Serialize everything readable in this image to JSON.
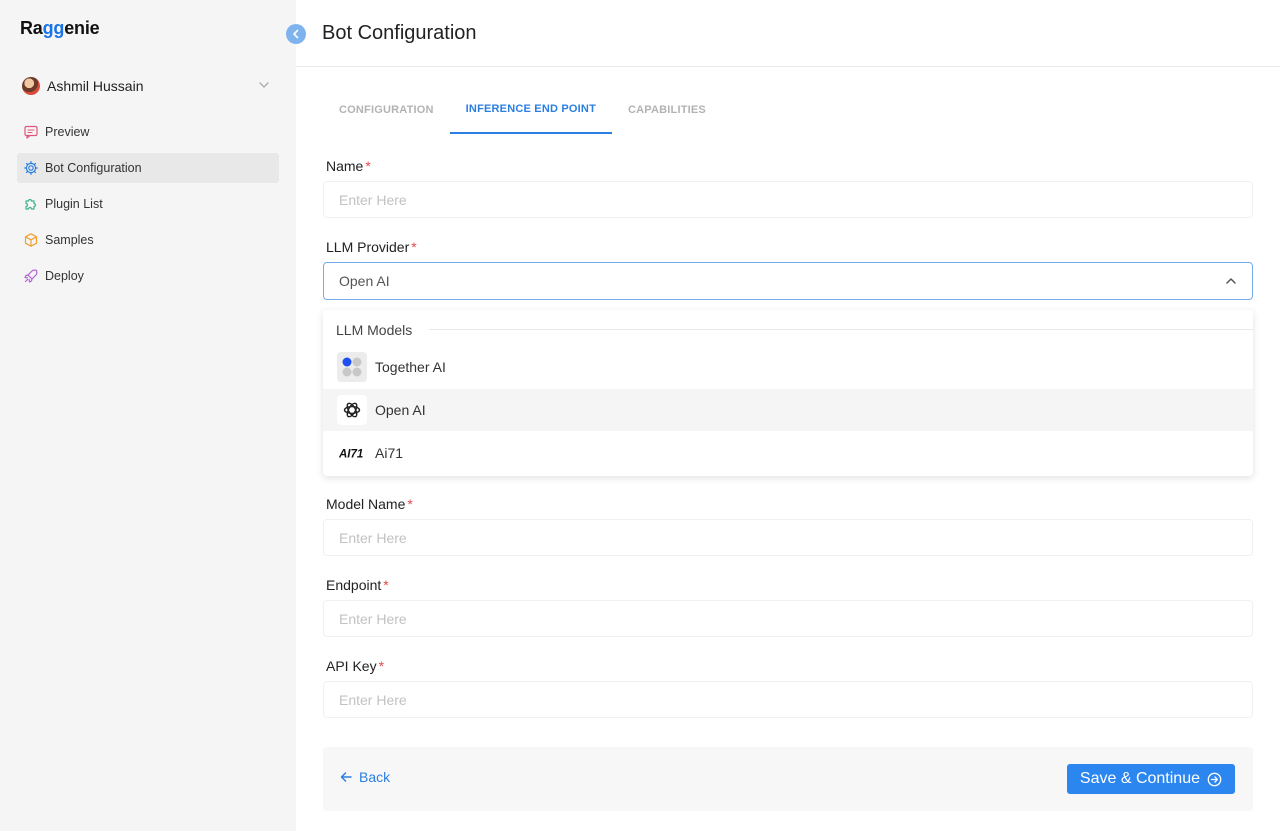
{
  "app": {
    "logo_pre": "Ra",
    "logo_accent": "gg",
    "logo_post": "enie"
  },
  "user": {
    "name": "Ashmil Hussain"
  },
  "sidebar": {
    "items": [
      {
        "label": "Preview",
        "icon": "chat-icon"
      },
      {
        "label": "Bot Configuration",
        "icon": "gear-icon",
        "active": true
      },
      {
        "label": "Plugin List",
        "icon": "puzzle-icon"
      },
      {
        "label": "Samples",
        "icon": "box-icon"
      },
      {
        "label": "Deploy",
        "icon": "rocket-icon"
      }
    ]
  },
  "header": {
    "title": "Bot Configuration"
  },
  "tabs": [
    {
      "label": "CONFIGURATION",
      "active": false
    },
    {
      "label": "INFERENCE END POINT",
      "active": true
    },
    {
      "label": "CAPABILITIES",
      "active": false
    }
  ],
  "form": {
    "name": {
      "label": "Name",
      "required": "*",
      "placeholder": "Enter Here",
      "value": ""
    },
    "provider": {
      "label": "LLM Provider",
      "required": "*",
      "value": "Open AI",
      "dropdown_group": "LLM Models",
      "options": [
        {
          "label": "Together AI",
          "icon": "together-ai-logo-icon"
        },
        {
          "label": "Open AI",
          "icon": "openai-logo-icon",
          "hovered": true
        },
        {
          "label": "Ai71",
          "icon": "ai71-logo-icon",
          "logo_text": "AI71"
        }
      ]
    },
    "model_name": {
      "label": "Model Name",
      "required": "*",
      "placeholder": "Enter Here",
      "value": ""
    },
    "endpoint": {
      "label": "Endpoint",
      "required": "*",
      "placeholder": "Enter Here",
      "value": ""
    },
    "api_key": {
      "label": "API Key",
      "required": "*",
      "placeholder": "Enter Here",
      "value": ""
    }
  },
  "footer": {
    "back_label": "Back",
    "save_label": "Save & Continue"
  },
  "colors": {
    "accent": "#2b86f0",
    "required": "#e5484d",
    "sidebar_bg": "#f5f5f5"
  }
}
